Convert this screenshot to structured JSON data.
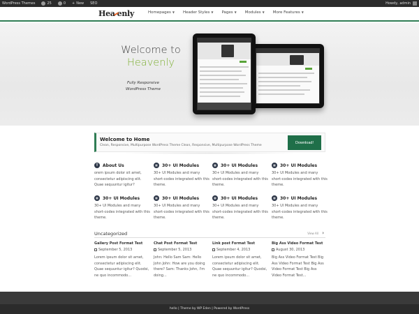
{
  "admin_bar": {
    "site_name": "WordPress Themes",
    "updates_count": "25",
    "comments_count": "0",
    "new_label": "New",
    "seo_label": "SEO",
    "greeting": "Howdy, admin"
  },
  "header": {
    "logo_prefix": "Hea",
    "logo_suffix": "enly",
    "nav": [
      {
        "label": "Homepages"
      },
      {
        "label": "Header Styles"
      },
      {
        "label": "Pages"
      },
      {
        "label": "Modules"
      },
      {
        "label": "More Features"
      }
    ]
  },
  "hero": {
    "title_line1": "Welcome to",
    "title_line2": "Heavenly",
    "subtitle_line1": "Fully Responsive",
    "subtitle_line2": "WordPress Theme"
  },
  "welcome": {
    "title": "Welcome to Home",
    "subtitle": "Clean, Responsive, Multipurpose WordPress Theme Clean, Responsive, Multipurpose WordPress Theme",
    "button": "Download!"
  },
  "features": [
    {
      "title": "About Us",
      "body": "orem ipsum dolor sit amet, consectetur adipiscing elit. Quae sequuntur igitur?"
    },
    {
      "title": "30+ UI Modules",
      "body": "30+ UI Modules and many short-codes integrated with this theme."
    },
    {
      "title": "30+ UI Modules",
      "body": "30+ UI Modules and many short-codes integrated with this theme."
    },
    {
      "title": "30+ UI Modules",
      "body": "30+ UI Modules and many short-codes integrated with this theme."
    },
    {
      "title": "30+ UI Modules",
      "body": "30+ UI Modules and many short-codes integrated with this theme."
    },
    {
      "title": "30+ UI Modules",
      "body": "30+ UI Modules and many short-codes integrated with this theme."
    },
    {
      "title": "30+ UI Modules",
      "body": "30+ UI Modules and many short-codes integrated with this theme."
    },
    {
      "title": "30+ UI Modules",
      "body": "30+ UI Modules and many short-codes integrated with this theme."
    }
  ],
  "uncategorized": {
    "title": "Uncategorized",
    "view_all": "View All"
  },
  "posts": [
    {
      "title": "Gallery Post Format Test",
      "date": "September 5, 2013",
      "body": "Lorem ipsum dolor sit amet, consectetur adipiscing elit. Quae sequuntur igitur? Quodsi, ne quo incommodo..."
    },
    {
      "title": "Chat Post Format Test",
      "date": "September 5, 2013",
      "body": "John: Hello Sam Sam: Hello John John: How are you doing there? Sam: Thanks John, I'm doing..."
    },
    {
      "title": "Link post Format Test",
      "date": "September 4, 2013",
      "body": "Lorem ipsum dolor sit amet, consectetur adipiscing elit. Quae sequuntur igitur? Quodsi, ne quo incommodo..."
    },
    {
      "title": "Big Ass Video Format Test",
      "date": "August 30, 2013",
      "body": "Big Ass Video Format Test Big Ass Video Format Test Big Ass Video Format Test Big Ass Video Format Test..."
    }
  ],
  "footer": {
    "text": "hello | Theme by WP Eden | Powered by WordPress"
  },
  "colors": {
    "brand_green": "#2f7d54",
    "accent_green": "#7fb037",
    "logo_accent": "#e4672d",
    "admin_bar": "#2b2b2b"
  },
  "icons": {
    "feature_icon_1": "t-circle-icon",
    "feature_icon_other": "grid-circle-icon",
    "nav_caret": "chevron-down-icon",
    "section_arrow": "chevron-right-icon",
    "post_date": "calendar-icon"
  }
}
